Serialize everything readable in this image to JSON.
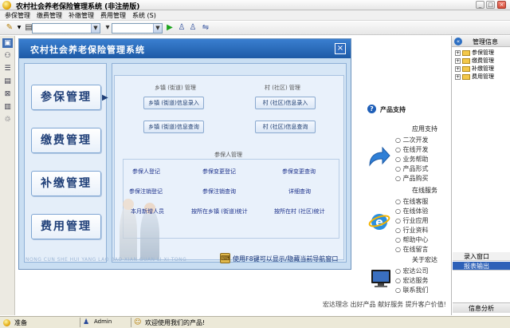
{
  "window": {
    "title": "农村社会养老保险管理系统 (非注册版)",
    "controls": {
      "minimize": "_",
      "maximize": "□",
      "close": "×"
    }
  },
  "menu": [
    "参保管理",
    "缴费管理",
    "补缴管理",
    "费用管理",
    "系统 (S)"
  ],
  "panel": {
    "title": "农村社会养老保险管理系统",
    "close": "×",
    "nav": [
      "参保管理",
      "缴费管理",
      "补缴管理",
      "费用管理"
    ],
    "arrow": "▶",
    "groups": {
      "township": {
        "title": "乡镇 (街道) 管理",
        "buttons": [
          "乡镇 (街道)信息录入",
          "乡镇 (街道)信息查询"
        ]
      },
      "village": {
        "title": "村 (社区) 管理",
        "buttons": [
          "村 (社区)信息录入",
          "村 (社区)信息查询"
        ]
      },
      "insured": {
        "title": "参保人管理",
        "links": [
          "参保人登记",
          "参保变更登记",
          "参保变更查询",
          "参保注销登记",
          "参保注销查询",
          "详细查询",
          "本月新增人员",
          "按所在乡镇 (街道)统计",
          "按所在村 (社区)统计"
        ]
      }
    },
    "bottom_text": "NONG CUN SHE HUI YANG LAO BAO XIAN GUAN LI XI TONG",
    "tip": "使用F8键可以显示/隐藏当前导航窗口"
  },
  "support": {
    "heading": "产品支持",
    "app_support": {
      "title": "应用支持",
      "items": [
        "二次开发",
        "在线开发",
        "业务帮助",
        "产品形式",
        "产品购买"
      ]
    },
    "online": {
      "title": "在线服务",
      "items": [
        "在线客服",
        "在线体验",
        "行业应用",
        "行业资料",
        "帮助中心",
        "在线留言"
      ]
    },
    "about": {
      "title": "关于宏达",
      "items": [
        "宏达公司",
        "宏达服务",
        "联系我们"
      ]
    },
    "slogan": "宏达理念 出好产品 献好服务 提升客户价值!"
  },
  "right_panel": {
    "title": "管理信息",
    "tree": [
      "参保管理",
      "缴费管理",
      "补缴管理",
      "费用管理"
    ],
    "buttons": [
      "录入窗口",
      "报表输出"
    ],
    "footer": "信息分析"
  },
  "status": {
    "ready": "准备",
    "user": "Admin",
    "welcome": "欢迎使用我们的产品!"
  },
  "colors": {
    "accent": "#1d5aa6",
    "panel_bg": "#c9def2"
  }
}
